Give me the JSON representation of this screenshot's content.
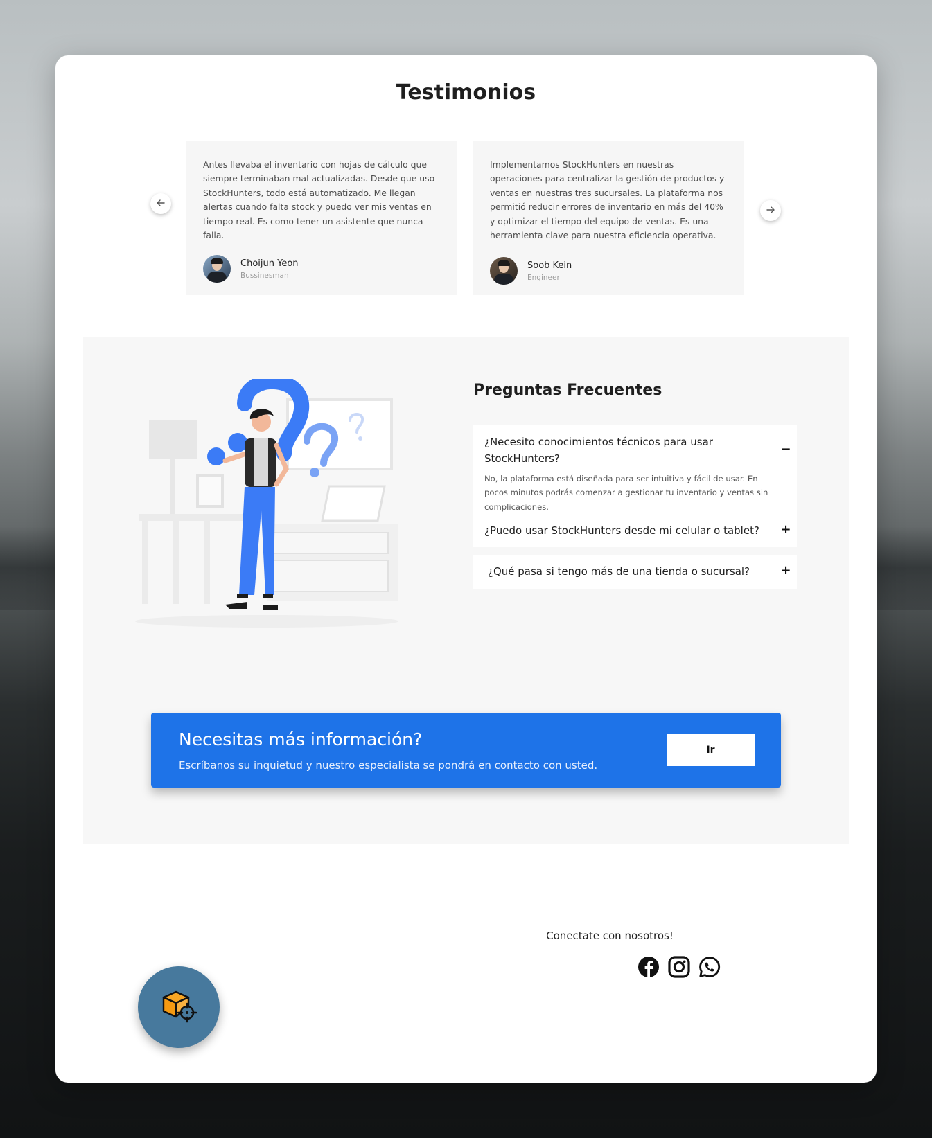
{
  "testimonials": {
    "title": "Testimonios",
    "items": [
      {
        "text": "Antes llevaba el inventario con hojas de cálculo que siempre terminaban mal actualizadas. Desde que uso StockHunters, todo está automatizado. Me llegan alertas cuando falta stock y puedo ver mis ventas en tiempo real. Es como tener un asistente que nunca falla.",
        "name": "Choijun Yeon",
        "role": "Bussinesman"
      },
      {
        "text": "Implementamos StockHunters en nuestras operaciones para centralizar la gestión de productos y ventas en nuestras tres sucursales. La plataforma nos permitió reducir errores de inventario en más del 40% y optimizar el tiempo del equipo de ventas. Es una herramienta clave para nuestra eficiencia operativa.",
        "name": "Soob Kein",
        "role": "Engineer"
      }
    ],
    "prev_icon": "arrow-left-icon",
    "next_icon": "arrow-right-icon"
  },
  "faq": {
    "title": "Preguntas Frecuentes",
    "items": [
      {
        "question": "¿Necesito conocimientos técnicos para usar StockHunters?",
        "answer": "No, la plataforma está diseñada para ser intuitiva y fácil de usar. En pocos minutos podrás comenzar a gestionar tu inventario y ventas sin complicaciones.",
        "expanded": true,
        "toggle": "−"
      },
      {
        "question": "¿Puedo usar StockHunters desde mi celular o tablet?",
        "expanded": false,
        "toggle": "+"
      },
      {
        "question": "¿Qué pasa si tengo más de una tienda o sucursal?",
        "expanded": false,
        "toggle": "+"
      }
    ]
  },
  "cta": {
    "title": "Necesitas más información?",
    "subtitle": "Escríbanos su inquietud y nuestro especialista se pondrá en contacto con usted.",
    "button": "Ir"
  },
  "footer": {
    "connect_label": "Conectate con nosotros!",
    "socials": [
      "facebook-icon",
      "instagram-icon",
      "whatsapp-icon"
    ]
  },
  "colors": {
    "accent": "#1e73e8",
    "fab": "#47799d",
    "illustration_blue": "#3b7bf6"
  }
}
